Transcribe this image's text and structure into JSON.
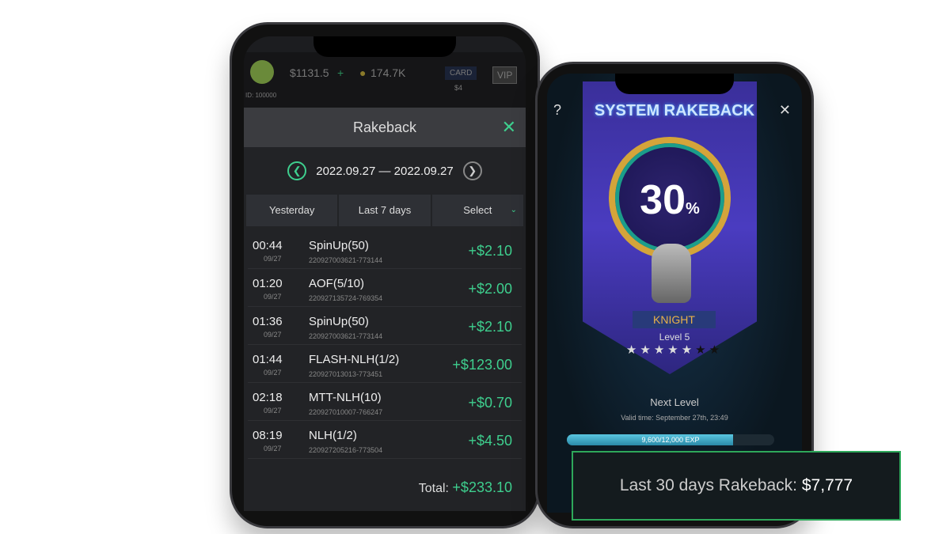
{
  "left_phone": {
    "topbar": {
      "cash": "$1131.5",
      "coins": "174.7K",
      "card_label": "CARD",
      "card_sub": "$4",
      "vip_label": "VIP",
      "user_id": "ID: 100000"
    },
    "modal": {
      "title": "Rakeback",
      "date_range": "2022.09.27 — 2022.09.27",
      "tabs": [
        {
          "label": "Yesterday"
        },
        {
          "label": "Last 7 days"
        },
        {
          "label": "Select"
        }
      ],
      "rows": [
        {
          "time": "00:44",
          "date": "09/27",
          "game": "SpinUp(50)",
          "id": "220927003621-773144",
          "amount": "+$2.10"
        },
        {
          "time": "01:20",
          "date": "09/27",
          "game": "AOF(5/10)",
          "id": "220927135724-769354",
          "amount": "+$2.00"
        },
        {
          "time": "01:36",
          "date": "09/27",
          "game": "SpinUp(50)",
          "id": "220927003621-773144",
          "amount": "+$2.10"
        },
        {
          "time": "01:44",
          "date": "09/27",
          "game": "FLASH-NLH(1/2)",
          "id": "220927013013-773451",
          "amount": "+$123.00"
        },
        {
          "time": "02:18",
          "date": "09/27",
          "game": "MTT-NLH(10)",
          "id": "220927010007-766247",
          "amount": "+$0.70"
        },
        {
          "time": "08:19",
          "date": "09/27",
          "game": "NLH(1/2)",
          "id": "220927205216-773504",
          "amount": "+$4.50"
        }
      ],
      "total_label": "Total:",
      "total_value": "+$233.10"
    }
  },
  "right_phone": {
    "title": "SYSTEM RAKEBACK",
    "help": "?",
    "close": "✕",
    "percent": "30",
    "percent_sign": "%",
    "rank": "KNIGHT",
    "level": "Level 5",
    "stars_filled": 5,
    "stars_total": 7,
    "next_level": "Next Level",
    "valid_time": "Valid time: September 27th, 23:49",
    "exp_text": "9,600/12,000 EXP",
    "exp_progress": 0.8
  },
  "banner": {
    "label": "Last 30 days Rakeback:",
    "value": "$7,777"
  },
  "colors": {
    "accent_green": "#3ecf8e",
    "gold": "#e8b24a"
  }
}
